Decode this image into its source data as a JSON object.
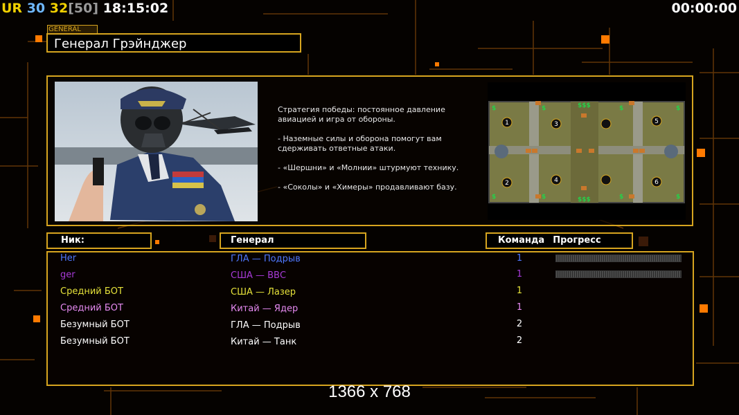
{
  "hud": {
    "ur": "UR",
    "n1": "30",
    "n2": "32",
    "n3": "[50]",
    "clock": "18:15:02",
    "timer": "00:00:00"
  },
  "general": {
    "tag": "GENERAL",
    "name": "Генерал Грэйнджер",
    "strategy": [
      "Стратегия победы: постоянное давление авиацией и игра от обороны.",
      "- Наземные силы и оборона помогут вам сдерживать ответные атаки.",
      "- «Шершни» и «Молнии» штурмуют технику.",
      "- «Соколы» и «Химеры» продавливают базу."
    ]
  },
  "minimap": {
    "start_positions": [
      "1",
      "2",
      "3",
      "4",
      "5",
      "6"
    ],
    "money_label": "$$$",
    "money_single": "$"
  },
  "table": {
    "headers": {
      "nick": "Ник:",
      "general": "Генерал",
      "team": "Команда",
      "progress": "Прогресс"
    },
    "rows": [
      {
        "nick": "Her",
        "general": "ГЛА — Подрыв",
        "team": "1",
        "color": "#4f78ff",
        "progress": true
      },
      {
        "nick": "ger",
        "general": "США — ВВС",
        "team": "1",
        "color": "#a83ad8",
        "progress": true
      },
      {
        "nick": "Средний БОТ",
        "general": "США — Лазер",
        "team": "1",
        "color": "#e6e23a",
        "progress": false
      },
      {
        "nick": "Средний БОТ",
        "general": "Китай — Ядер",
        "team": "1",
        "color": "#e68af0",
        "progress": false
      },
      {
        "nick": "Безумный БОТ",
        "general": "ГЛА — Подрыв",
        "team": "2",
        "color": "#ffffff",
        "progress": false
      },
      {
        "nick": "Безумный БОТ",
        "general": "Китай — Танк",
        "team": "2",
        "color": "#ffffff",
        "progress": false
      }
    ]
  },
  "resolution_label": "1366 x 768",
  "colors": {
    "accent": "#d7a51f",
    "orange": "#ff7a00"
  }
}
